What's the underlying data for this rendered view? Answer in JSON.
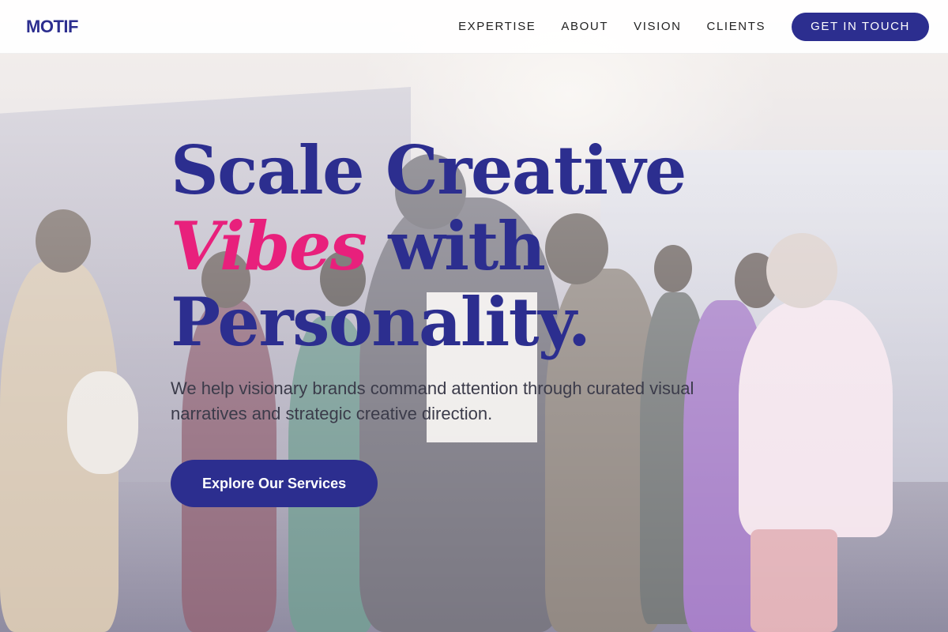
{
  "brand": {
    "logo_text": "MOTIF"
  },
  "nav": {
    "links": [
      {
        "label": "EXPERTISE"
      },
      {
        "label": "ABOUT"
      },
      {
        "label": "VISION"
      },
      {
        "label": "CLIENTS"
      }
    ],
    "cta_label": "GET IN TOUCH"
  },
  "hero": {
    "headline_line1": "Scale Creative",
    "headline_accent": "Vibes",
    "headline_line2_rest": " with",
    "headline_line3": "Personality.",
    "subtitle": "We help visionary brands command attention through curated visual narratives and strategic creative direction.",
    "cta_label": "Explore Our Services"
  },
  "colors": {
    "primary": "#2c2e8f",
    "accent": "#e8207c",
    "text_muted": "#3b3b4a"
  }
}
